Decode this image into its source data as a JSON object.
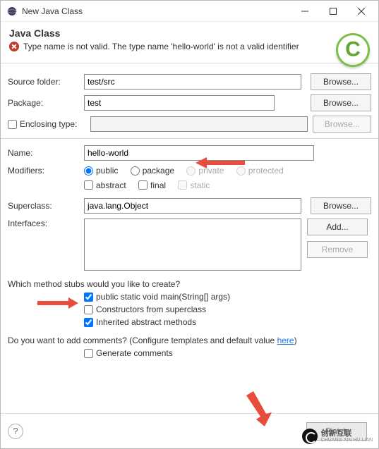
{
  "window": {
    "title": "New Java Class"
  },
  "header": {
    "title": "Java Class",
    "error": "Type name is not valid. The type name 'hello-world' is not a valid identifier"
  },
  "labels": {
    "sourceFolder": "Source folder:",
    "packageLbl": "Package:",
    "enclosing": "Enclosing type:",
    "name": "Name:",
    "modifiers": "Modifiers:",
    "superclass": "Superclass:",
    "interfaces": "Interfaces:"
  },
  "fields": {
    "sourceFolder": "test/src",
    "packageVal": "test",
    "enclosingVal": "",
    "nameVal": "hello-world",
    "superclassVal": "java.lang.Object"
  },
  "buttons": {
    "browse": "Browse...",
    "add": "Add...",
    "remove": "Remove",
    "finish": "Finish"
  },
  "modifiers": {
    "pub": "public",
    "pkg": "package",
    "priv": "private",
    "prot": "protected",
    "abs": "abstract",
    "fin": "final",
    "stat": "static"
  },
  "stubsQuestion": "Which method stubs would you like to create?",
  "stubs": {
    "main": "public static void main(String[] args)",
    "constructors": "Constructors from superclass",
    "inherited": "Inherited abstract methods"
  },
  "commentsQuestion_pre": "Do you want to add comments? (Configure templates and default value ",
  "commentsQuestion_link": "here",
  "commentsQuestion_post": ")",
  "generateComments": "Generate comments",
  "watermark": {
    "top": "创新互联",
    "sub": "CHUANG XIN HU LIAN"
  }
}
